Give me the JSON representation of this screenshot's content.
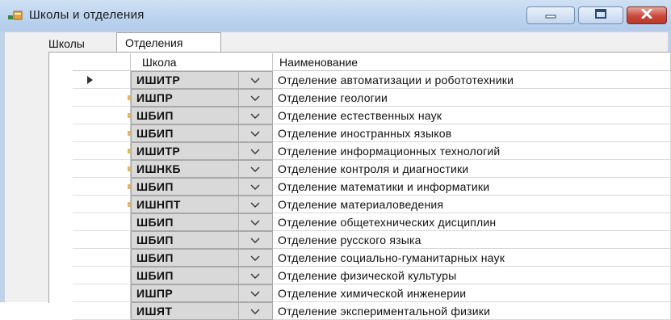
{
  "window": {
    "title": "Школы и отделения",
    "icon": "window-app-icon",
    "controls": [
      "minimize-icon",
      "maximize-icon",
      "close-icon"
    ]
  },
  "tabs": [
    {
      "label": "Школы",
      "selected": false
    },
    {
      "label": "Отделения",
      "selected": true
    }
  ],
  "grid": {
    "columns": [
      "Школа",
      "Наименование"
    ],
    "current_row_indicator": "row-pointer-icon",
    "rows": [
      {
        "school": "ИШИТР",
        "name": "Отделение автоматизации и робототехники"
      },
      {
        "school": "ИШПР",
        "name": "Отделение геологии"
      },
      {
        "school": "ШБИП",
        "name": "Отделение естественных наук"
      },
      {
        "school": "ШБИП",
        "name": "Отделение иностранных языков"
      },
      {
        "school": "ИШИТР",
        "name": "Отделение информационных технологий"
      },
      {
        "school": "ИШНКБ",
        "name": "Отделение контроля и диагностики"
      },
      {
        "school": "ШБИП",
        "name": "Отделение математики и информатики"
      },
      {
        "school": "ИШНПТ",
        "name": "Отделение материаловедения"
      },
      {
        "school": "ШБИП",
        "name": "Отделение общетехнических дисциплин"
      },
      {
        "school": "ШБИП",
        "name": "Отделение русского языка"
      },
      {
        "school": "ШБИП",
        "name": "Отделение социально-гуманитарных наук"
      },
      {
        "school": "ШБИП",
        "name": "Отделение физической культуры"
      },
      {
        "school": "ИШПР",
        "name": "Отделение химической инженерии"
      },
      {
        "school": "ИШЯТ",
        "name": "Отделение экспериментальной физики"
      }
    ]
  }
}
